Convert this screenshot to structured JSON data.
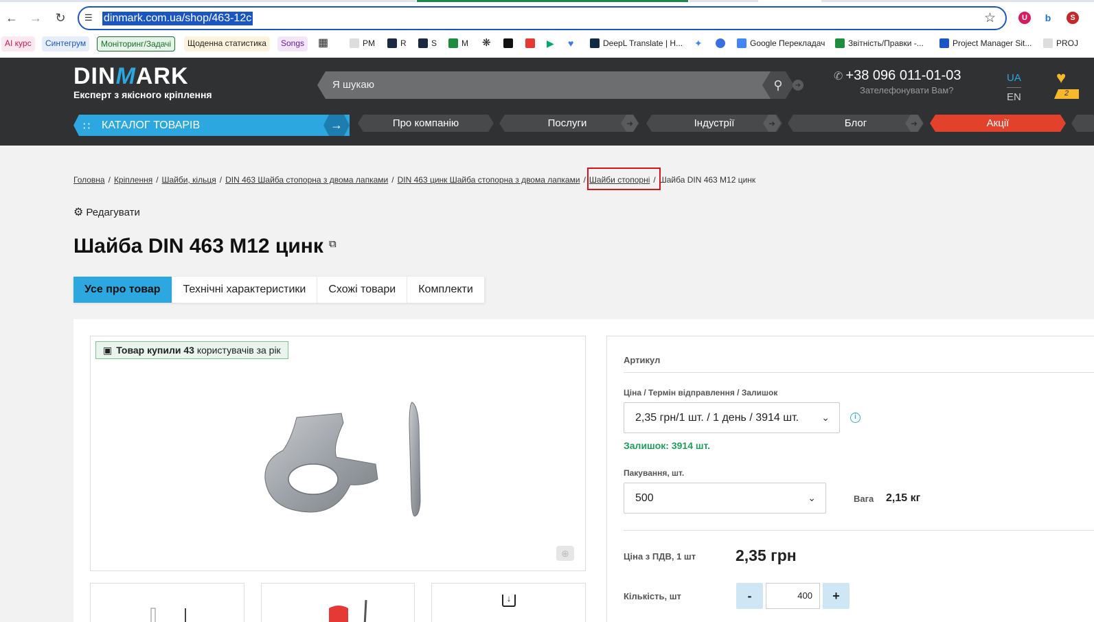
{
  "browser": {
    "url": "dinmark.com.ua/shop/463-12c",
    "bookmarks": [
      {
        "label": "AI курс",
        "color": "#c2185b",
        "bg": "#fde8ef"
      },
      {
        "label": "Синтегрум",
        "color": "#1a55c4",
        "bg": "#e6eefc"
      },
      {
        "label": "Моніторинг/Задачі",
        "color": "#1d6b2f",
        "bg": "#e4f4e6"
      },
      {
        "label": "Щоденна статистика",
        "color": "#222",
        "bg": "#fdf3dc"
      },
      {
        "label": "Songs",
        "color": "#6a1b9a",
        "bg": "#f3e6f9"
      },
      {
        "label": "PM"
      },
      {
        "label": "R"
      },
      {
        "label": "S"
      },
      {
        "label": "M"
      },
      {
        "label": "DeepL Translate | Н..."
      },
      {
        "label": "Google Перекладач"
      },
      {
        "label": "Звітність/Правки -..."
      },
      {
        "label": "Project Manager Sit..."
      },
      {
        "label": "PROJ"
      }
    ]
  },
  "header": {
    "logo_main": "DIN",
    "logo_m": "M",
    "logo_end": "ARK",
    "logo_sub": "Експерт з якісного кріплення",
    "search_placeholder": "Я шукаю",
    "phone": "+38 096 011-01-03",
    "callback": "Зателефонувати Вам?",
    "lang_ua": "UA",
    "lang_en": "EN",
    "wishlist_count": "2",
    "catalog_label": "КАТАЛОГ ТОВАРІВ",
    "nav": [
      "Про компанію",
      "Послуги",
      "Індустрії",
      "Блог",
      "Акції"
    ],
    "accent": "#2da7e0",
    "sale_color": "#e2412b"
  },
  "breadcrumbs": [
    "Головна",
    "Кріплення",
    "Шайби, кільця",
    "DIN 463 Шайба стопорна з двома лапками",
    "DIN 463 цинк Шайба стопорна з двома лапками",
    "Шайби стопорні",
    "Шайба DIN 463 M12 цинк"
  ],
  "edit_label": "Редагувати",
  "product": {
    "title": "Шайба DIN 463 M12 цинк",
    "tabs": [
      "Усе про товар",
      "Технічні характеристики",
      "Схожі товари",
      "Комплекти"
    ],
    "buyers_prefix": "Товар купили",
    "buyers_count": "43",
    "buyers_suffix": "користувачів за рік",
    "sku_label": "Артикул",
    "price_term_label": "Ціна / Термін відправлення / Залишок",
    "price_term_value": "2,35 грн/1 шт. / 1 день / 3914 шт.",
    "stock_text": "Залишок: 3914 шт.",
    "pack_label": "Пакування, шт.",
    "pack_value": "500",
    "weight_label": "Вага",
    "weight_value": "2,15 кг",
    "price_label": "Ціна з ПДВ, 1 шт",
    "price_value": "2,35 грн",
    "qty_label": "Кількість, шт",
    "qty_value": "400",
    "qty_minus": "-",
    "qty_plus": "+"
  }
}
